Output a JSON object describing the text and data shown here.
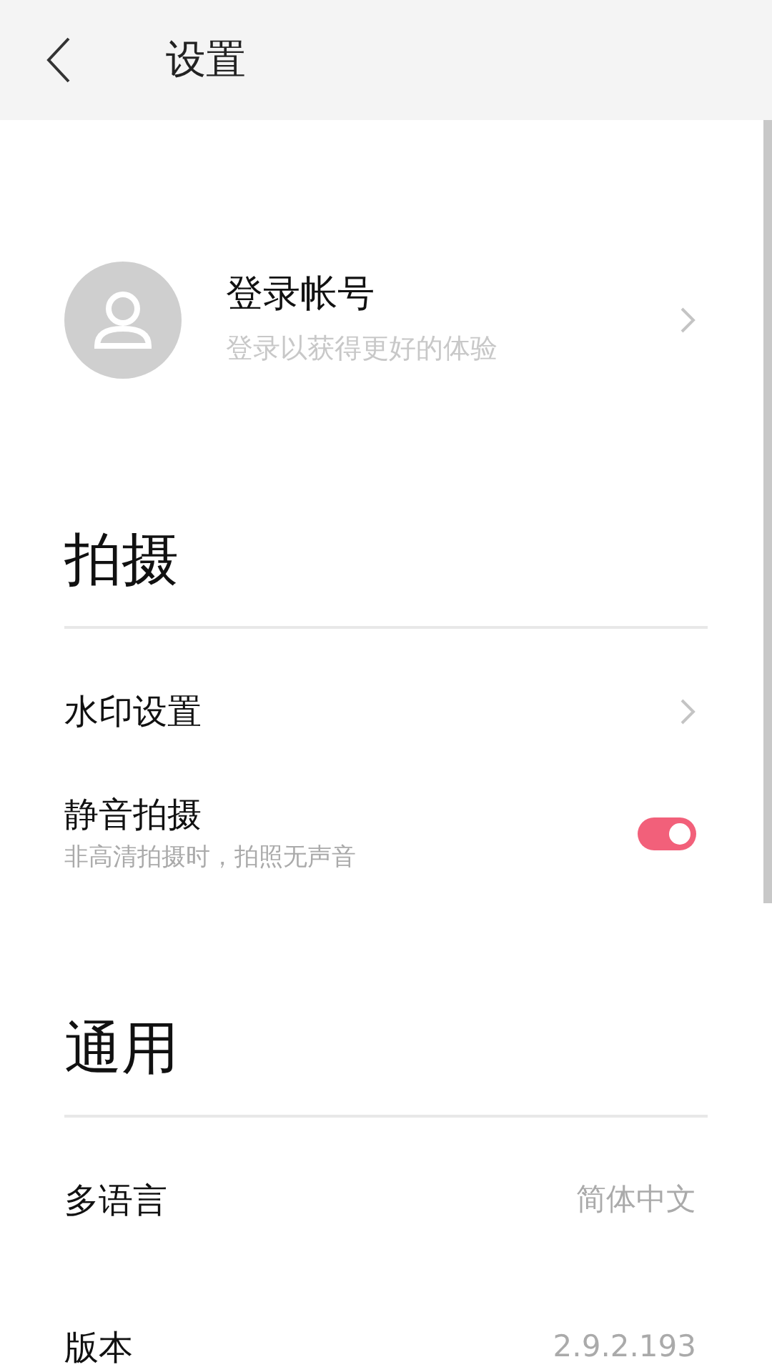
{
  "header": {
    "title": "设置"
  },
  "account": {
    "title": "登录帐号",
    "subtitle": "登录以获得更好的体验"
  },
  "sections": [
    {
      "title": "拍摄",
      "items": [
        {
          "kind": "link",
          "label": "水印设置"
        },
        {
          "kind": "switch",
          "label": "静音拍摄",
          "description": "非高清拍摄时，拍照无声音",
          "on": true
        }
      ]
    },
    {
      "title": "通用",
      "items": [
        {
          "kind": "value",
          "label": "多语言",
          "value": "简体中文"
        },
        {
          "kind": "value",
          "label": "版本",
          "value": "2.9.2.193"
        }
      ]
    }
  ]
}
